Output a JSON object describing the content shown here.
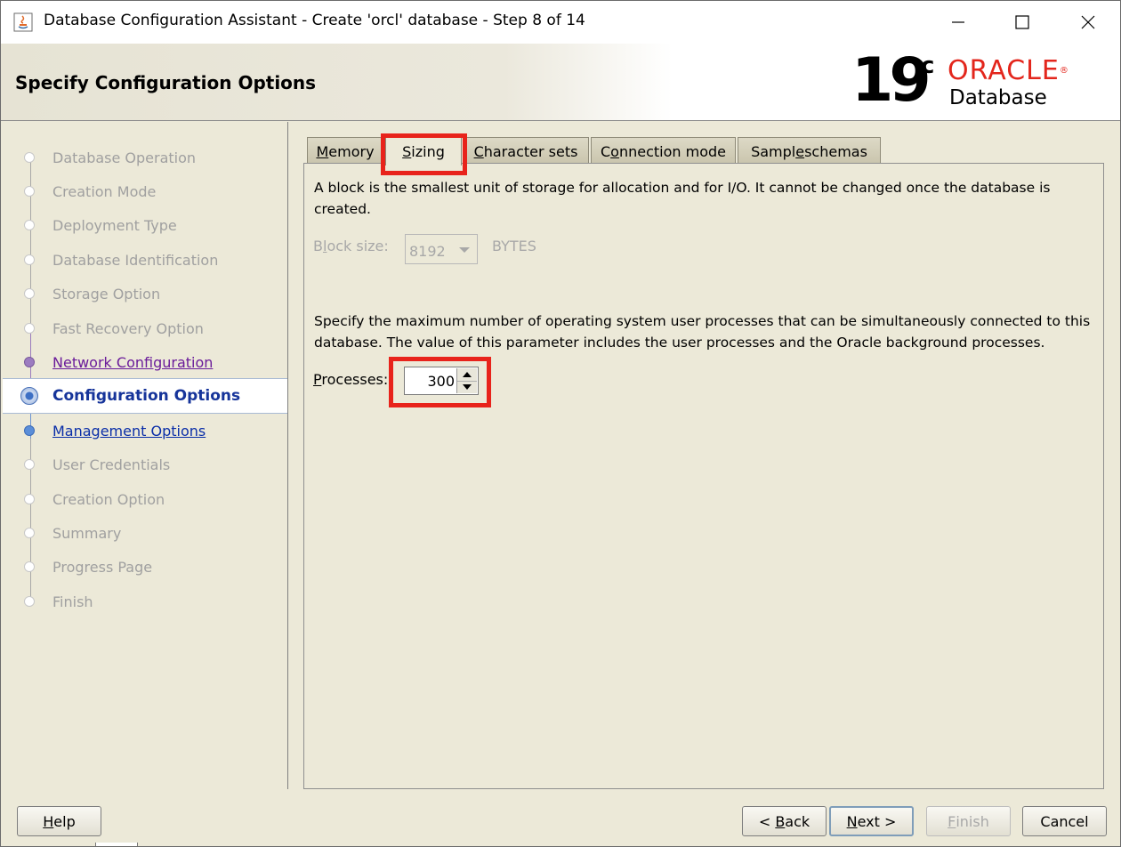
{
  "window": {
    "title": "Database Configuration Assistant - Create 'orcl' database - Step 8 of 14",
    "minimize_symbol": "—",
    "maximize_symbol": "☐",
    "close_symbol": "✕"
  },
  "header": {
    "title": "Specify Configuration Options",
    "logo_version": "19",
    "logo_c": "c",
    "logo_brand": "ORACLE",
    "logo_brand_mark": "®",
    "logo_product": "Database"
  },
  "sidebar": {
    "steps": [
      {
        "label": "Database Operation",
        "state": "disabled"
      },
      {
        "label": "Creation Mode",
        "state": "disabled"
      },
      {
        "label": "Deployment Type",
        "state": "disabled"
      },
      {
        "label": "Database Identification",
        "state": "disabled"
      },
      {
        "label": "Storage Option",
        "state": "disabled"
      },
      {
        "label": "Fast Recovery Option",
        "state": "disabled"
      },
      {
        "label": "Network Configuration",
        "state": "visited"
      },
      {
        "label": "Configuration Options",
        "state": "current"
      },
      {
        "label": "Management Options",
        "state": "link"
      },
      {
        "label": "User Credentials",
        "state": "disabled"
      },
      {
        "label": "Creation Option",
        "state": "disabled"
      },
      {
        "label": "Summary",
        "state": "disabled"
      },
      {
        "label": "Progress Page",
        "state": "disabled"
      },
      {
        "label": "Finish",
        "state": "disabled"
      }
    ]
  },
  "tabs": [
    {
      "pre": "",
      "key": "M",
      "post": "emory"
    },
    {
      "pre": "",
      "key": "S",
      "post": "izing"
    },
    {
      "pre": "",
      "key": "C",
      "post": "haracter sets"
    },
    {
      "pre": "C",
      "key": "o",
      "post": "nnection mode"
    },
    {
      "pre": "Sampl",
      "key": "e",
      "post": " schemas"
    }
  ],
  "sizing": {
    "block_desc_line1": "A block is the smallest unit of storage for allocation and for I/O. It cannot be changed once the database is",
    "block_desc_line2": "created.",
    "block_label_pre": "B",
    "block_label_key": "l",
    "block_label_post": "ock size:",
    "block_value": "8192",
    "block_unit": "BYTES",
    "proc_desc_line1": "Specify the maximum number of operating system user processes that can be simultaneously connected to this",
    "proc_desc_line2": "database. The value of this parameter includes the user processes and the Oracle background processes.",
    "processes_label_key": "P",
    "processes_label_post": "rocesses:",
    "processes_value": "300"
  },
  "buttons": {
    "help_key": "H",
    "help_post": "elp",
    "back_pre": "< ",
    "back_key": "B",
    "back_post": "ack",
    "next_key": "N",
    "next_post": "ext >",
    "finish_key": "F",
    "finish_post": "inish",
    "cancel": "Cancel"
  },
  "colors": {
    "highlight": "#e8231b",
    "oracle_red": "#e3261c",
    "current_step": "#16349a",
    "link": "#0a2ea8",
    "visited": "#6a1b9a"
  }
}
